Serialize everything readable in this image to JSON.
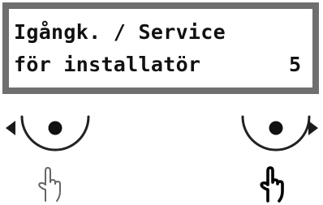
{
  "display": {
    "line1": "Igångk. / Service",
    "line2": "för installatör",
    "menu_number": "5"
  },
  "controls": {
    "left": {
      "arrow_icon": "triangle-left",
      "button_icon": "dot-in-arc",
      "hand_icon": "pointing-hand-outline"
    },
    "right": {
      "arrow_icon": "triangle-right",
      "button_icon": "dot-in-arc",
      "hand_icon": "pointing-hand-bold"
    }
  },
  "colors": {
    "frame": "#6f6f6f",
    "text": "#111111",
    "hand_outline": "#666666",
    "hand_bold": "#000000"
  }
}
